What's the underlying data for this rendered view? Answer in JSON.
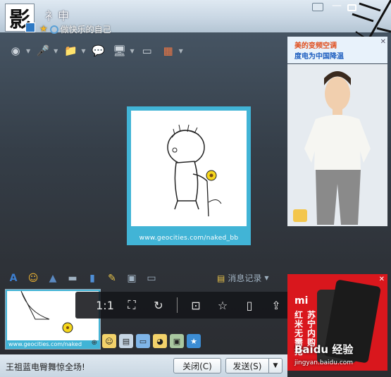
{
  "title_bar": {
    "avatar_glyph": "影",
    "contact_name": "衤申",
    "signature": "做快乐的自己",
    "window_buttons": [
      "menu",
      "minimize",
      "maximize"
    ]
  },
  "toolbar": {
    "tools": [
      {
        "icon": "camera-icon"
      },
      {
        "icon": "microphone-icon"
      },
      {
        "icon": "folder-icon"
      },
      {
        "icon": "message-add-icon"
      },
      {
        "icon": "screen-share-icon"
      },
      {
        "icon": "remote-desktop-icon"
      },
      {
        "icon": "apps-grid-icon"
      }
    ]
  },
  "ad_banner": {
    "line1": "美的变频空调",
    "line2": "度电为中国降温"
  },
  "chat_image": {
    "caption": "www.geocities.com/naked_bb"
  },
  "input_toolbar": {
    "message_record_label": "消息记录"
  },
  "viewer": {
    "ratio_label": "1:1"
  },
  "thumbnail": {
    "caption": "www.geocities.com/naked"
  },
  "bottom_ad": {
    "brand": "mi",
    "col1": "红米无需抢",
    "col2": "苏宁内购",
    "watermark": "Baidu 经验",
    "watermark_sub": "jingyan.baidu.com"
  },
  "status_bar": {
    "text": "王祖蓝电臀舞惊全场!",
    "close_label": "关闭(C)",
    "send_label": "发送(S)"
  },
  "colors": {
    "image_border": "#41b4d6",
    "ad_red": "#d9171d",
    "title_gradient_top": "#dfe9f2"
  }
}
